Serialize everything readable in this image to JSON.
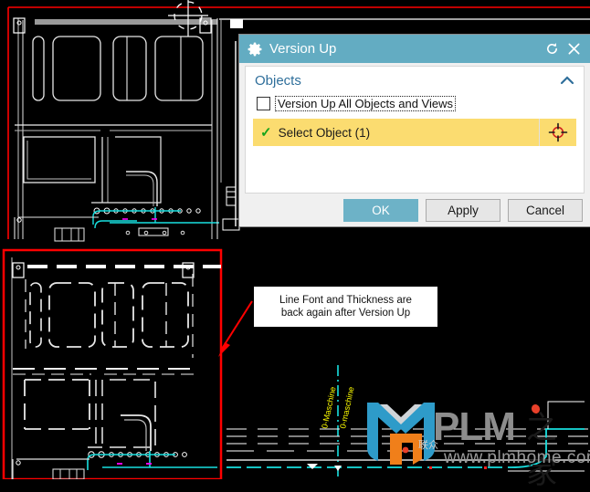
{
  "dialog": {
    "title": "Version Up",
    "gear_icon": "gear-icon",
    "reset_icon": "reset-icon",
    "close_icon": "close-icon",
    "group": {
      "title": "Objects",
      "collapse_icon": "chevron-up-icon"
    },
    "checkbox": {
      "label": "Version Up All Objects and Views",
      "checked": false
    },
    "select_row": {
      "label": "Select Object (1)",
      "status_icon": "green-check-icon",
      "picker_icon": "crosshair-target-icon",
      "highlight_color": "#FBDC70"
    },
    "buttons": {
      "ok": "OK",
      "apply": "Apply",
      "cancel": "Cancel"
    },
    "colors": {
      "titlebar": "#63ACC2",
      "primary_button": "#6DB2C7",
      "group_title": "#2F6F9B"
    }
  },
  "annotation": {
    "line1": "Line Font and Thickness are",
    "line2": "back again after Version Up",
    "arrow_color": "#FF0000"
  },
  "cad": {
    "background": "#000000",
    "line_color": "#FFFFFF",
    "highlight_border_color": "#FF0000",
    "pipe_color": "#18E0E0",
    "label_color": "#FFFF00",
    "labels": [
      "0-Maschine",
      "0-maschine"
    ],
    "top_view_name": "top-cad-viewport",
    "bottom_view_name": "bottom-cad-viewport",
    "cursor_icon": "crosshair-cursor"
  },
  "watermark": {
    "brand": "PLM",
    "brand_cn": "之家",
    "url": "www.plmhome.com",
    "mark": "联众",
    "logo_icon": "plm-logo-icon",
    "colors": {
      "blue": "#2E9BC9",
      "orange": "#F07F1A",
      "gray": "#8D8D8D",
      "red": "#E8402A"
    }
  }
}
